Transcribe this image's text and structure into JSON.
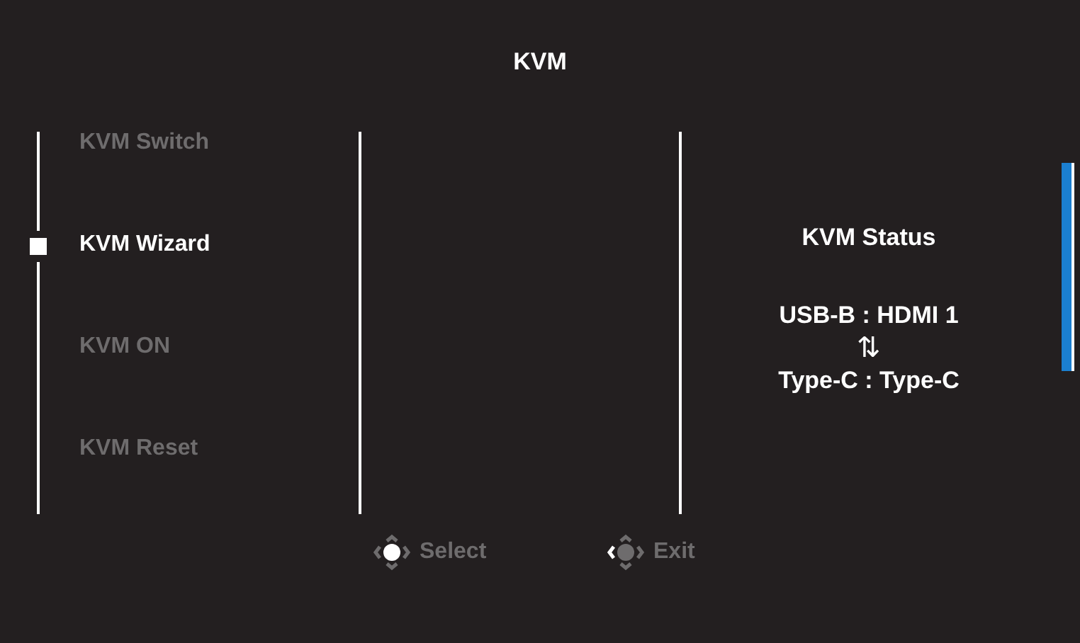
{
  "title": "KVM",
  "menu": [
    {
      "label": "KVM Switch",
      "selected": false
    },
    {
      "label": "KVM Wizard",
      "selected": true
    },
    {
      "label": "KVM ON",
      "selected": false
    },
    {
      "label": "KVM Reset",
      "selected": false
    }
  ],
  "status": {
    "heading": "KVM Status",
    "upper": "USB-B : HDMI 1",
    "arrows": "⇅",
    "lower": "Type-C : Type-C"
  },
  "footer": [
    {
      "label": "Select",
      "kind": "press"
    },
    {
      "label": "Exit",
      "kind": "left"
    }
  ]
}
